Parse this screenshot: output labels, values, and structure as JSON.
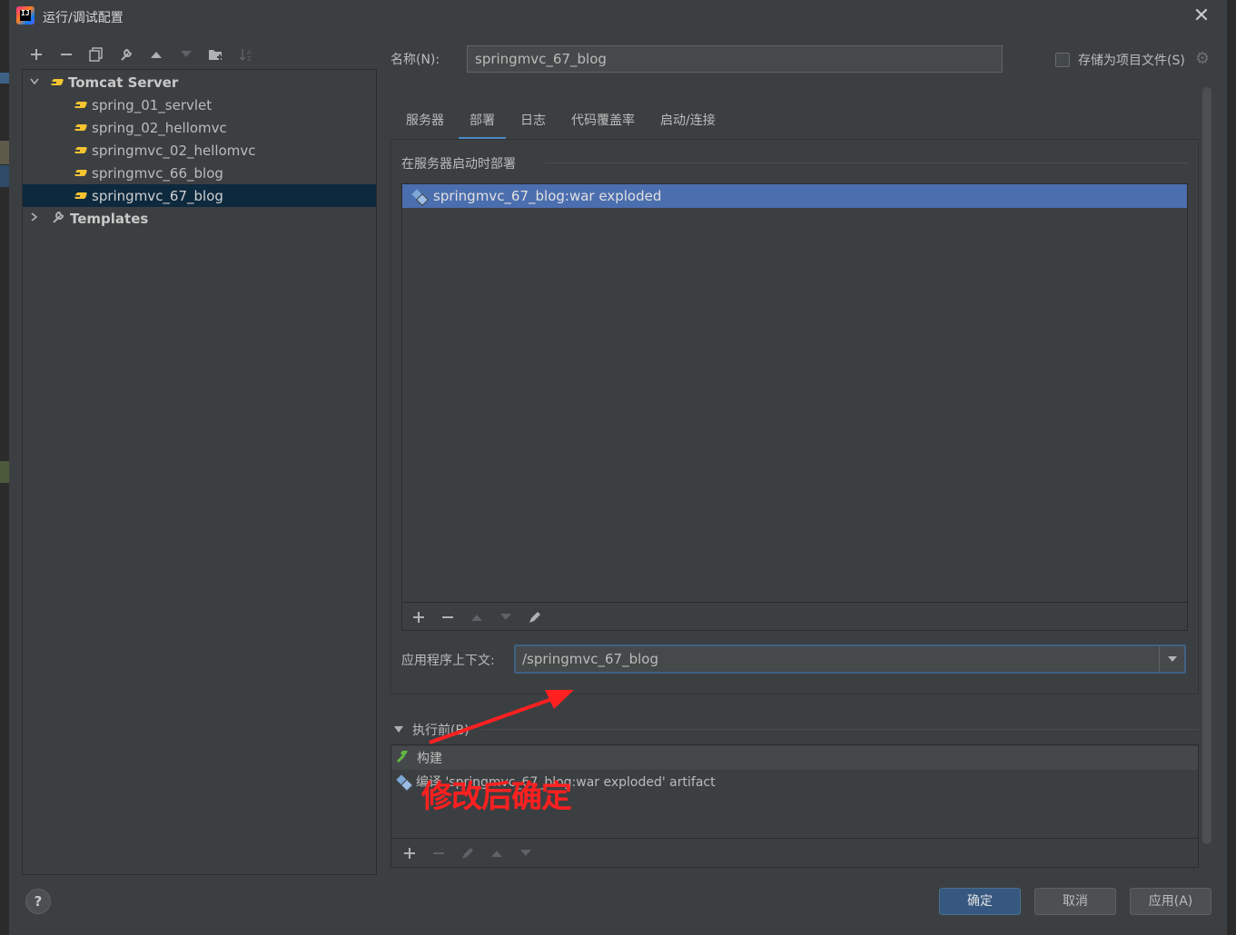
{
  "window": {
    "title": "运行/调试配置"
  },
  "toolbar": {
    "buttons": [
      "add",
      "remove",
      "copy",
      "edit-templates",
      "move-up",
      "move-down",
      "new-folder",
      "sort"
    ]
  },
  "tree": {
    "root": {
      "label": "Tomcat Server",
      "expanded": true
    },
    "children": [
      {
        "label": "spring_01_servlet"
      },
      {
        "label": "spring_02_hellomvc"
      },
      {
        "label": "springmvc_02_hellomvc"
      },
      {
        "label": "springmvc_66_blog"
      },
      {
        "label": "springmvc_67_blog",
        "selected": true
      }
    ],
    "templates": {
      "label": "Templates",
      "expanded": false
    }
  },
  "header": {
    "name_label": "名称(N):",
    "name_value": "springmvc_67_blog",
    "store_label": "存储为项目文件(S)",
    "store_checked": false
  },
  "tabs": [
    {
      "label": "服务器"
    },
    {
      "label": "部署",
      "active": true
    },
    {
      "label": "日志"
    },
    {
      "label": "代码覆盖率"
    },
    {
      "label": "启动/连接"
    }
  ],
  "deploy": {
    "section_title": "在服务器启动时部署",
    "items": [
      {
        "label": "springmvc_67_blog:war exploded",
        "selected": true
      }
    ]
  },
  "context": {
    "label": "应用程序上下文:",
    "value": "/springmvc_67_blog"
  },
  "before_launch": {
    "title": "执行前(B)",
    "items": [
      {
        "label": "构建"
      },
      {
        "label": "编译 'springmvc_67_blog:war exploded' artifact"
      }
    ]
  },
  "annotation": {
    "text": "修改后确定",
    "color": "#ff2020"
  },
  "footer": {
    "help": "?",
    "ok": "确定",
    "cancel": "取消",
    "apply": "应用(A)"
  },
  "colors": {
    "background": "#3c3f41",
    "selection": "#4b6eaf",
    "tree_selection": "#0d293e",
    "primary_button": "#365880",
    "active_tab": "#4a88c7"
  }
}
